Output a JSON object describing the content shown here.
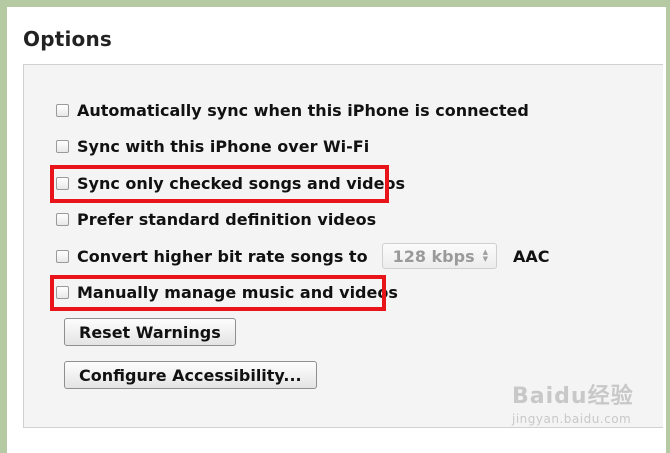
{
  "section": {
    "title": "Options"
  },
  "options": [
    {
      "label": "Automatically sync when this iPhone is connected",
      "checked": false
    },
    {
      "label": "Sync with this iPhone over Wi-Fi",
      "checked": false
    },
    {
      "label": "Sync only checked songs and videos",
      "checked": false,
      "highlighted": true
    },
    {
      "label": "Prefer standard definition videos",
      "checked": false
    },
    {
      "label": "Convert higher bit rate songs to",
      "checked": false,
      "bitrate_value": "128 kbps",
      "format": "AAC"
    },
    {
      "label": "Manually manage music and videos",
      "checked": false,
      "highlighted": true
    }
  ],
  "buttons": {
    "reset_warnings": "Reset Warnings",
    "configure_accessibility": "Configure Accessibility..."
  },
  "watermark": {
    "logo": "Baidu经验",
    "url": "jingyan.baidu.com"
  },
  "colors": {
    "highlight": "#e8141a",
    "background_border": "#b5c9a2"
  }
}
